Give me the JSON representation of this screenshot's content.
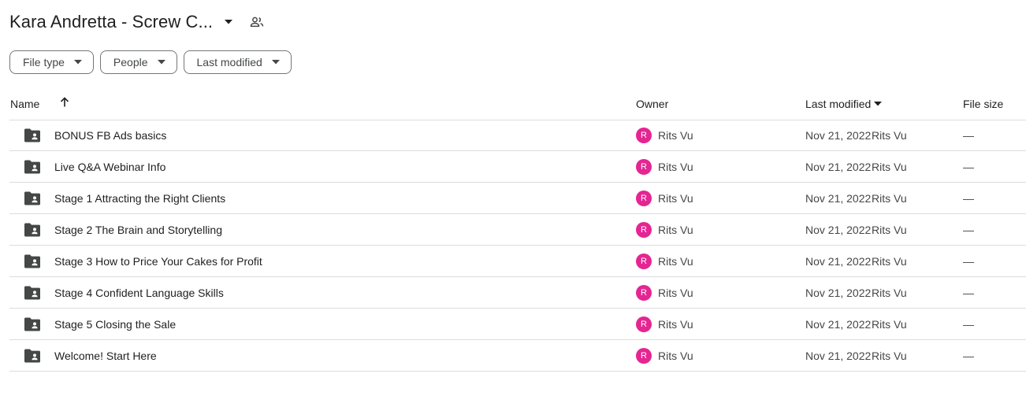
{
  "header": {
    "title": "Kara Andretta - Screw C...",
    "caret_icon": "arrow-drop-down-icon",
    "shared_icon": "people-icon"
  },
  "filters": [
    {
      "label": "File type"
    },
    {
      "label": "People"
    },
    {
      "label": "Last modified"
    }
  ],
  "columns": {
    "name": "Name",
    "owner": "Owner",
    "last_modified": "Last modified",
    "file_size": "File size",
    "name_sort": "ascending-arrow-icon",
    "modified_sort": "descending-caret-icon"
  },
  "rows": [
    {
      "name": "BONUS FB Ads basics",
      "owner_initial": "R",
      "owner": "Rits Vu",
      "modified": "Nov 21, 2022",
      "modified_by": "Rits Vu",
      "size": "—"
    },
    {
      "name": "Live Q&A Webinar Info",
      "owner_initial": "R",
      "owner": "Rits Vu",
      "modified": "Nov 21, 2022",
      "modified_by": "Rits Vu",
      "size": "—"
    },
    {
      "name": "Stage 1 Attracting the Right Clients",
      "owner_initial": "R",
      "owner": "Rits Vu",
      "modified": "Nov 21, 2022",
      "modified_by": "Rits Vu",
      "size": "—"
    },
    {
      "name": "Stage 2 The Brain and Storytelling",
      "owner_initial": "R",
      "owner": "Rits Vu",
      "modified": "Nov 21, 2022",
      "modified_by": "Rits Vu",
      "size": "—"
    },
    {
      "name": "Stage 3 How to Price Your Cakes for Profit",
      "owner_initial": "R",
      "owner": "Rits Vu",
      "modified": "Nov 21, 2022",
      "modified_by": "Rits Vu",
      "size": "—"
    },
    {
      "name": "Stage 4 Confident Language Skills",
      "owner_initial": "R",
      "owner": "Rits Vu",
      "modified": "Nov 21, 2022",
      "modified_by": "Rits Vu",
      "size": "—"
    },
    {
      "name": "Stage 5 Closing the Sale",
      "owner_initial": "R",
      "owner": "Rits Vu",
      "modified": "Nov 21, 2022",
      "modified_by": "Rits Vu",
      "size": "—"
    },
    {
      "name": "Welcome! Start Here",
      "owner_initial": "R",
      "owner": "Rits Vu",
      "modified": "Nov 21, 2022",
      "modified_by": "Rits Vu",
      "size": "—"
    }
  ],
  "colors": {
    "avatar": "#e52592",
    "text": "#1f1f1f",
    "secondary_text": "#444746",
    "divider": "#dadce0",
    "folder_icon": "#444746"
  }
}
